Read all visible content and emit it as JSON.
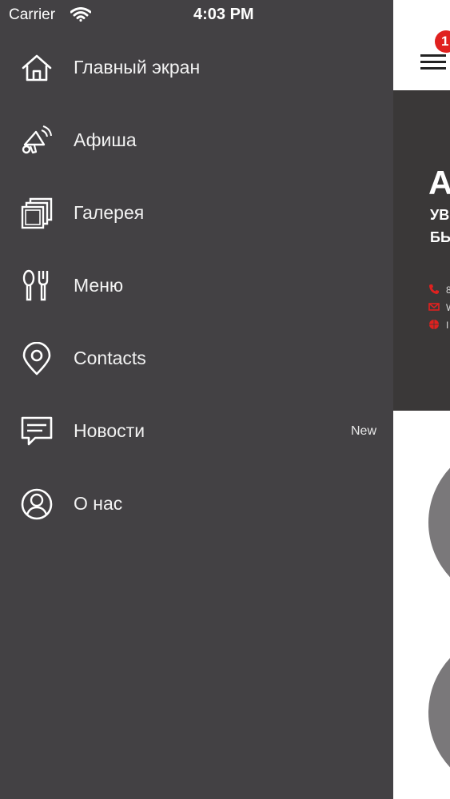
{
  "status_bar": {
    "carrier": "Carrier",
    "time": "4:03 PM"
  },
  "drawer": {
    "items": [
      {
        "label": "Главный экран",
        "icon": "home-icon"
      },
      {
        "label": "Афиша",
        "icon": "megaphone-icon"
      },
      {
        "label": "Галерея",
        "icon": "gallery-icon"
      },
      {
        "label": "Меню",
        "icon": "cutlery-icon"
      },
      {
        "label": "Contacts",
        "icon": "location-pin-icon"
      },
      {
        "label": "Новости",
        "icon": "chat-icon",
        "badge": "New"
      },
      {
        "label": "О нас",
        "icon": "user-circle-icon"
      }
    ]
  },
  "app_page": {
    "notification_count": "1",
    "hero_title": "А",
    "hero_subtitle_1": "УВ",
    "hero_subtitle_2": "БЬ",
    "contact_lines": [
      "8",
      "W",
      "I"
    ]
  },
  "colors": {
    "drawer_bg": "#434144",
    "accent": "#e0211f",
    "hero_bg": "#3a3838"
  }
}
